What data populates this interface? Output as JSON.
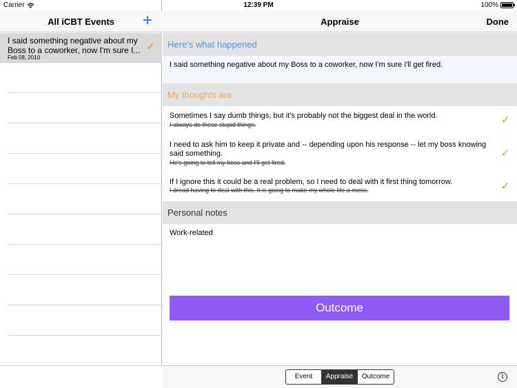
{
  "status_bar": {
    "carrier": "Carrier",
    "time": "12:39 PM",
    "battery": "100%"
  },
  "left_nav": {
    "title": "All iCBT Events",
    "add_label": "+"
  },
  "events": [
    {
      "text": "I said something negative about my Boss to a coworker, now I'm sure I...",
      "date": "Feb 08, 2010",
      "check": "✓"
    }
  ],
  "right_nav": {
    "title": "Appraise",
    "done_label": "Done"
  },
  "sections": {
    "happened_header": "Here's what happened",
    "happened_text": "I said something negative about my Boss to a coworker, now I'm sure I'll get fired.",
    "thoughts_header": "My thoughts are",
    "notes_header": "Personal notes",
    "notes_text": "Work-related"
  },
  "thoughts": [
    {
      "new": "Sometimes I say dumb things, but it's probably not the biggest deal in the world.",
      "old": "I always do these stupid things.",
      "check": "✓"
    },
    {
      "new": "I need to ask him to keep it private and -- depending upon his response -- let my boss knowing said something.",
      "old": "He's going to tell my boss and I'll get fired.",
      "check": "✓"
    },
    {
      "new": "If I ignore this it could be a real problem, so I need to deal with it first thing tomorrow.",
      "old": "I dread having to deal with this.  It is going to make my whole life a mess.",
      "check": "✓"
    }
  ],
  "outcome_button": "Outcome",
  "segments": [
    "Event",
    "Appraise",
    "Outcome"
  ],
  "active_segment": "Appraise",
  "info_label": "i",
  "colors": {
    "accent_blue": "#1a73e8",
    "check_orange": "#f0962d",
    "outcome_purple": "#8f5cf7"
  }
}
